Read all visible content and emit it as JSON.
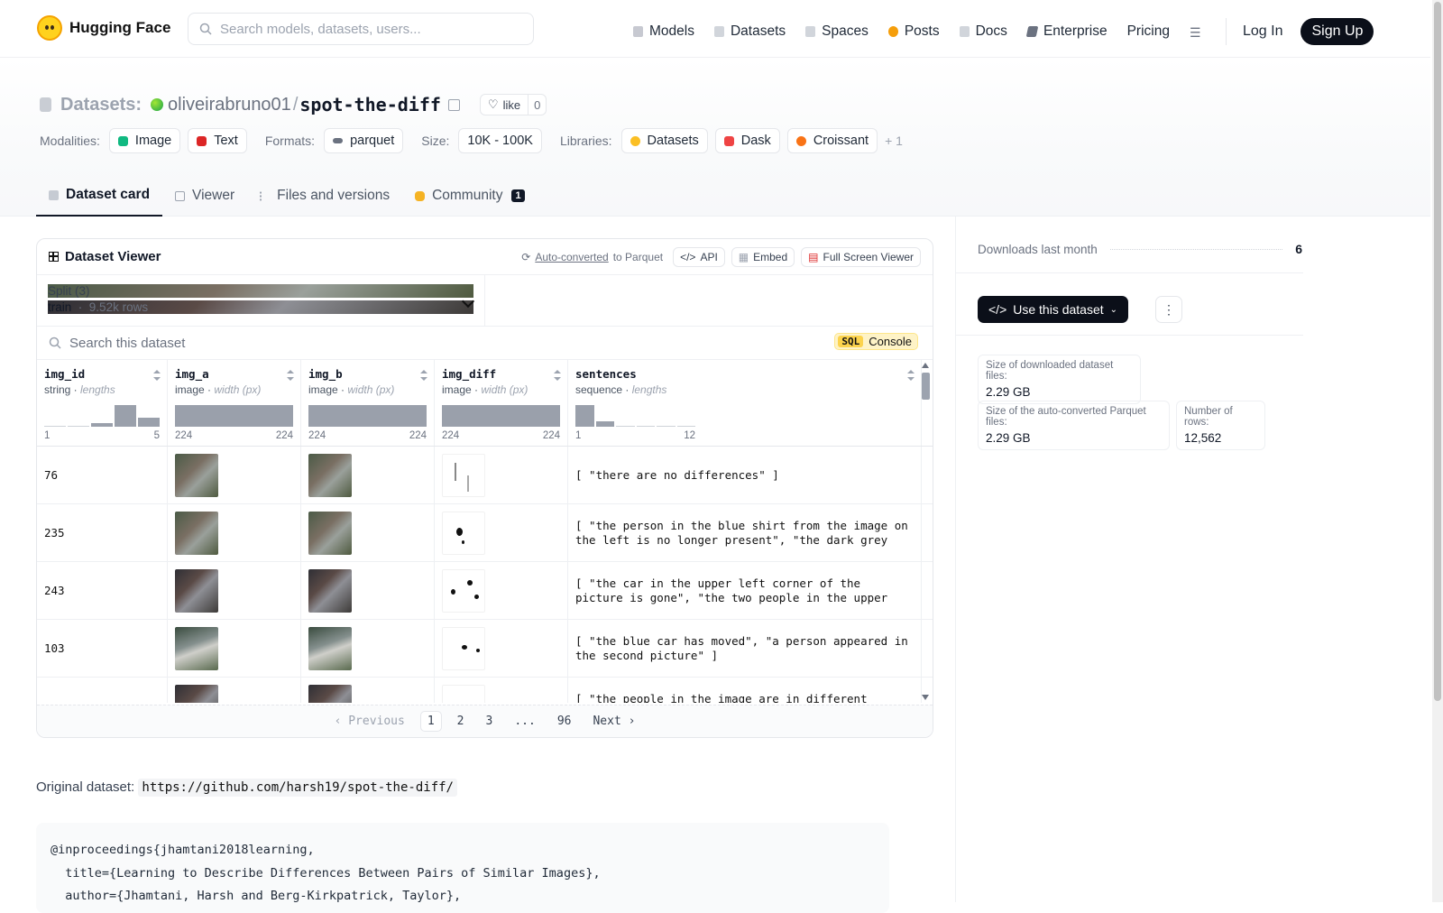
{
  "nav": {
    "brand": "Hugging Face",
    "search_placeholder": "Search models, datasets, users...",
    "links": [
      "Models",
      "Datasets",
      "Spaces",
      "Posts",
      "Docs",
      "Enterprise",
      "Pricing"
    ],
    "login": "Log In",
    "signup": "Sign Up"
  },
  "header": {
    "section": "Datasets:",
    "owner": "oliveirabruno01",
    "repo": "spot-the-diff",
    "like_label": "like",
    "like_count": "0",
    "modalities_label": "Modalities:",
    "modalities": [
      "Image",
      "Text"
    ],
    "formats_label": "Formats:",
    "format": "parquet",
    "size_label": "Size:",
    "size": "10K - 100K",
    "libraries_label": "Libraries:",
    "libraries": [
      "Datasets",
      "Dask",
      "Croissant"
    ],
    "libraries_more": "+ 1"
  },
  "tabs": {
    "card": "Dataset card",
    "viewer": "Viewer",
    "files": "Files and versions",
    "community": "Community",
    "community_count": "1"
  },
  "viewer": {
    "title": "Dataset Viewer",
    "auto_link": "Auto-converted",
    "auto_suffix": "to Parquet",
    "api": "API",
    "embed": "Embed",
    "fullscreen": "Full Screen Viewer",
    "split_label": "Split (3)",
    "split_name": "train",
    "split_rows": "9.52k rows",
    "search_placeholder": "Search this dataset",
    "sql_badge": "SQL",
    "sql_label": "Console",
    "columns": [
      {
        "name": "img_id",
        "type": "string",
        "stat": "lengths",
        "min": "1",
        "max": "5"
      },
      {
        "name": "img_a",
        "type": "image",
        "stat": "width (px)",
        "min": "224",
        "max": "224"
      },
      {
        "name": "img_b",
        "type": "image",
        "stat": "width (px)",
        "min": "224",
        "max": "224"
      },
      {
        "name": "img_diff",
        "type": "image",
        "stat": "width (px)",
        "min": "224",
        "max": "224"
      },
      {
        "name": "sentences",
        "type": "sequence",
        "stat": "lengths",
        "min": "1",
        "max": "12"
      }
    ],
    "rows": [
      {
        "id": "76",
        "sentences": "[ \"there are no differences\" ]"
      },
      {
        "id": "235",
        "sentences": "[ \"the person in the blue shirt from the image on the left is no longer present\", \"the dark grey suv is gone\" ]"
      },
      {
        "id": "243",
        "sentences": "[ \"the car in the upper left corner of the picture is gone\", \"the two people in the upper part of the picture are gone\" ]"
      },
      {
        "id": "103",
        "sentences": "[ \"the blue car has moved\", \"a person appeared in the second picture\" ]"
      },
      {
        "id": "",
        "sentences": "[ \"the people in the image are in different places"
      }
    ],
    "pager": {
      "prev": "Previous",
      "pages": [
        "1",
        "2",
        "3",
        "...",
        "96"
      ],
      "next": "Next"
    }
  },
  "card": {
    "orig_label": "Original dataset:",
    "orig_url": "https://github.com/harsh19/spot-the-diff/",
    "bibtex": "@inproceedings{jhamtani2018learning,\n  title={Learning to Describe Differences Between Pairs of Similar Images},\n  author={Jhamtani, Harsh and Berg-Kirkpatrick, Taylor},"
  },
  "sidebar": {
    "downloads_label": "Downloads last month",
    "downloads": "6",
    "use_button": "Use this dataset",
    "stats": [
      {
        "label": "Size of downloaded dataset files:",
        "value": "2.29 GB"
      },
      {
        "label": "Size of the auto-converted Parquet files:",
        "value": "2.29 GB"
      },
      {
        "label": "Number of rows:",
        "value": "12,562"
      }
    ]
  }
}
